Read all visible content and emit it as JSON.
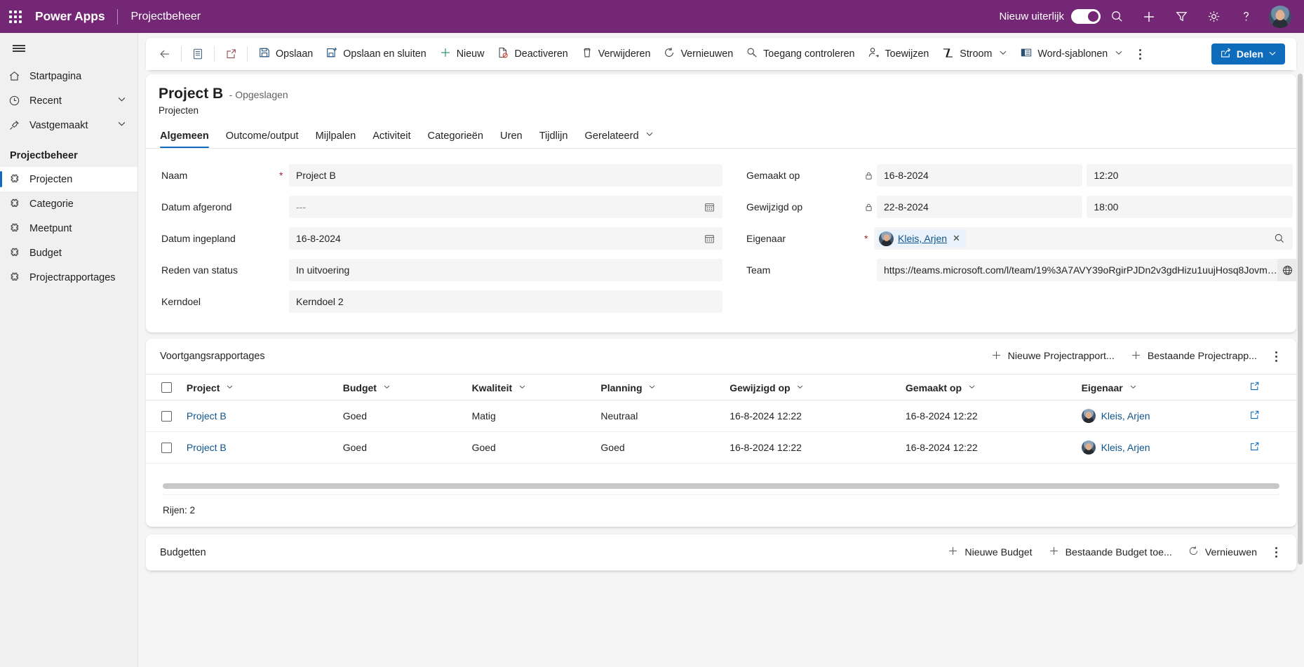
{
  "appbar": {
    "waffle_icon": "waffle-icon",
    "brand": "Power Apps",
    "app_name": "Projectbeheer",
    "new_look_label": "Nieuw uiterlijk",
    "new_look_on": true,
    "icons": [
      "search-icon",
      "add-icon",
      "filter-icon",
      "gear-icon",
      "help-icon",
      "avatar"
    ],
    "brand_color": "#742774"
  },
  "sidebar": {
    "hamburger": "hamburger-icon",
    "items": [
      {
        "label": "Startpagina",
        "icon": "home-icon",
        "expandable": false,
        "selected": false
      },
      {
        "label": "Recent",
        "icon": "clock-icon",
        "expandable": true,
        "selected": false
      },
      {
        "label": "Vastgemaakt",
        "icon": "pin-icon",
        "expandable": true,
        "selected": false
      }
    ],
    "group_title": "Projectbeheer",
    "group_items": [
      {
        "label": "Projecten",
        "icon": "entity-icon",
        "selected": true
      },
      {
        "label": "Categorie",
        "icon": "entity-icon",
        "selected": false
      },
      {
        "label": "Meetpunt",
        "icon": "entity-icon",
        "selected": false
      },
      {
        "label": "Budget",
        "icon": "entity-icon",
        "selected": false
      },
      {
        "label": "Projectrapportages",
        "icon": "entity-icon",
        "selected": false
      }
    ]
  },
  "commandbar": {
    "back_icon": "back-arrow-icon",
    "form_icon": "form-selector-icon",
    "popout_icon": "open-in-new-window-icon",
    "buttons": [
      {
        "label": "Opslaan",
        "icon": "save-icon"
      },
      {
        "label": "Opslaan en sluiten",
        "icon": "save-and-close-icon"
      },
      {
        "label": "Nieuw",
        "icon": "plus-icon"
      },
      {
        "label": "Deactiveren",
        "icon": "deactivate-icon"
      },
      {
        "label": "Verwijderen",
        "icon": "trash-icon"
      },
      {
        "label": "Vernieuwen",
        "icon": "refresh-icon"
      },
      {
        "label": "Toegang controleren",
        "icon": "check-access-icon"
      },
      {
        "label": "Toewijzen",
        "icon": "assign-user-icon"
      },
      {
        "label": "Stroom",
        "icon": "flow-icon",
        "has_chevron": true
      },
      {
        "label": "Word-sjablonen",
        "icon": "word-template-icon",
        "has_chevron": true
      }
    ],
    "overflow_label": "more-commands",
    "share": {
      "label": "Delen",
      "icon": "share-icon",
      "has_chevron": true,
      "color": "#0f6cbd"
    }
  },
  "record": {
    "title": "Project B",
    "state": "- Opgeslagen",
    "entity": "Projecten",
    "tabs": [
      {
        "label": "Algemeen",
        "active": true
      },
      {
        "label": "Outcome/output",
        "active": false
      },
      {
        "label": "Mijlpalen",
        "active": false
      },
      {
        "label": "Activiteit",
        "active": false
      },
      {
        "label": "Categorieën",
        "active": false
      },
      {
        "label": "Uren",
        "active": false
      },
      {
        "label": "Tijdlijn",
        "active": false
      },
      {
        "label": "Gerelateerd",
        "active": false,
        "has_chevron": true
      }
    ]
  },
  "form": {
    "left": [
      {
        "label": "Naam",
        "value": "Project B",
        "required": true,
        "type": "text"
      },
      {
        "label": "Datum afgerond",
        "value": "---",
        "placeholder": "---",
        "required": false,
        "type": "date",
        "empty": true
      },
      {
        "label": "Datum ingepland",
        "value": "16-8-2024",
        "required": false,
        "type": "date"
      },
      {
        "label": "Reden van status",
        "value": "In uitvoering",
        "required": false,
        "type": "choice"
      },
      {
        "label": "Kerndoel",
        "value": "Kerndoel 2",
        "required": false,
        "type": "choice"
      }
    ],
    "right": [
      {
        "label": "Gemaakt op",
        "locked": true,
        "type": "datetime",
        "value": "16-8-2024",
        "value2": "12:20"
      },
      {
        "label": "Gewijzigd op",
        "locked": true,
        "type": "datetime",
        "value": "22-8-2024",
        "value2": "18:00"
      },
      {
        "label": "Eigenaar",
        "required": true,
        "type": "lookup",
        "chip": "Kleis, Arjen"
      },
      {
        "label": "Team",
        "type": "url",
        "value": "https://teams.microsoft.com/l/team/19%3A7AVY39oRgirPJDn2v3gdHizu1uujHosq8Jovm…"
      }
    ]
  },
  "subgrid": {
    "title": "Voortgangsrapportages",
    "actions": [
      {
        "label": "Nieuwe Projectrapport...",
        "icon": "plus-icon"
      },
      {
        "label": "Bestaande Projectrapp...",
        "icon": "plus-icon"
      }
    ],
    "overflow_label": "more-subgrid-commands",
    "columns": [
      "Project",
      "Budget",
      "Kwaliteit",
      "Planning",
      "Gewijzigd op",
      "Gemaakt op",
      "Eigenaar"
    ],
    "rows": [
      {
        "project": "Project B",
        "budget": "Goed",
        "kwaliteit": "Matig",
        "planning": "Neutraal",
        "gewijzigd_op": "16-8-2024 12:22",
        "gemaakt_op": "16-8-2024 12:22",
        "eigenaar": "Kleis, Arjen"
      },
      {
        "project": "Project B",
        "budget": "Goed",
        "kwaliteit": "Goed",
        "planning": "Goed",
        "gewijzigd_op": "16-8-2024 12:22",
        "gemaakt_op": "16-8-2024 12:22",
        "eigenaar": "Kleis, Arjen"
      }
    ],
    "footer": "Rijen: 2"
  },
  "budgets": {
    "title": "Budgetten",
    "actions": [
      {
        "label": "Nieuwe Budget",
        "icon": "plus-icon"
      },
      {
        "label": "Bestaande Budget toe...",
        "icon": "plus-icon"
      },
      {
        "label": "Vernieuwen",
        "icon": "refresh-icon"
      }
    ],
    "overflow_label": "more-budget-commands"
  }
}
